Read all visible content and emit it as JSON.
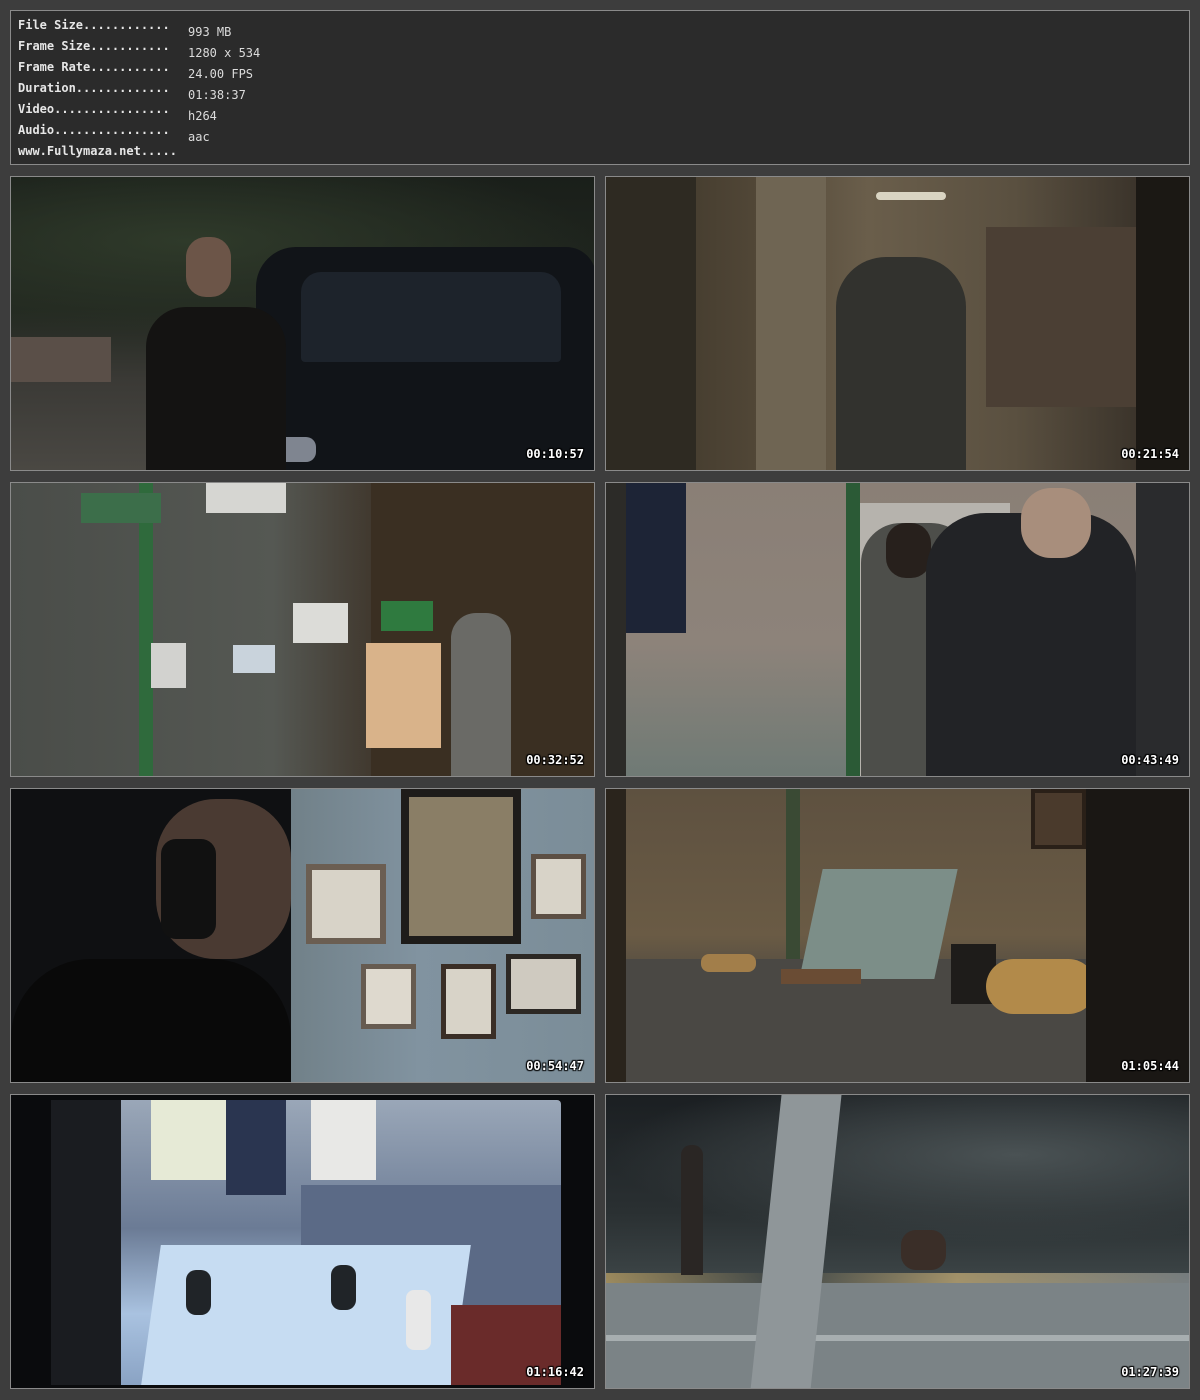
{
  "info": {
    "file_size_label": "File Size............",
    "file_size": "993 MB",
    "frame_size_label": "Frame Size...........",
    "frame_size": "1280 x 534",
    "frame_rate_label": "Frame Rate...........",
    "frame_rate": "24.00 FPS",
    "duration_label": "Duration.............",
    "duration": "01:38:37",
    "video_label": "Video................",
    "video": "h264",
    "audio_label": "Audio................",
    "audio": "aac",
    "website": "www.Fullymaza.net....."
  },
  "thumbnails": [
    {
      "timestamp": "00:10:57"
    },
    {
      "timestamp": "00:21:54"
    },
    {
      "timestamp": "00:32:52"
    },
    {
      "timestamp": "00:43:49"
    },
    {
      "timestamp": "00:54:47"
    },
    {
      "timestamp": "01:05:44"
    },
    {
      "timestamp": "01:16:42"
    },
    {
      "timestamp": "01:27:39"
    }
  ]
}
